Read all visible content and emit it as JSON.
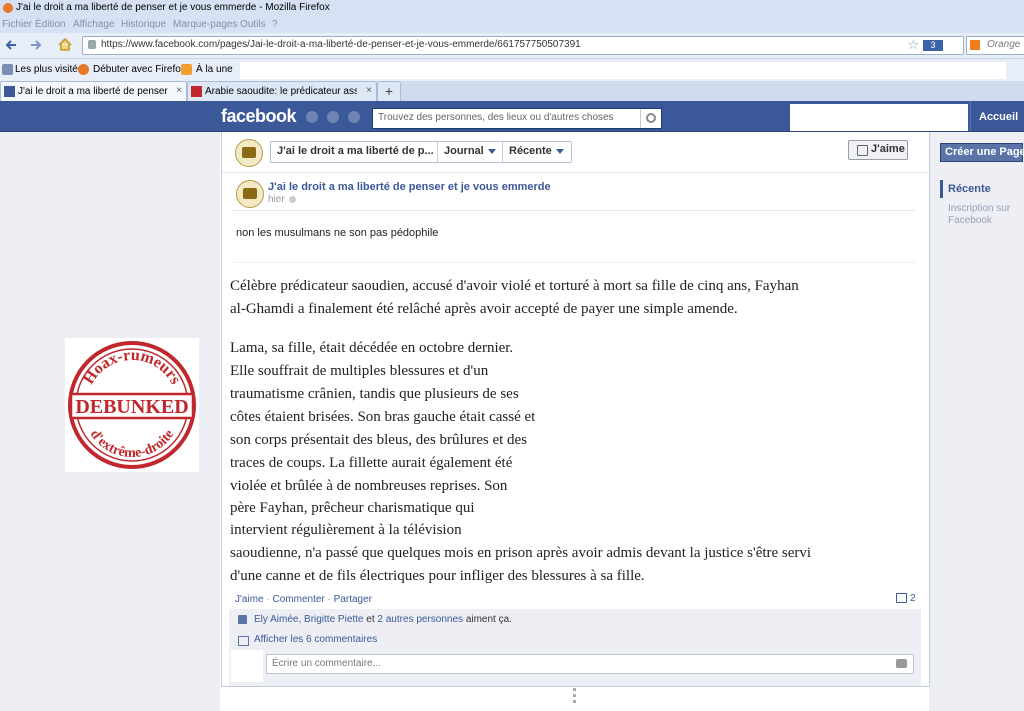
{
  "browser": {
    "window_title": "J'ai le droit a ma liberté de penser et je vous emmerde - Mozilla Firefox",
    "menu": [
      "Fichier",
      "Édition",
      "Affichage",
      "Historique",
      "Marque-pages",
      "Outils",
      "?"
    ],
    "url": "https://www.facebook.com/pages/Jai-le-droit-a-ma-liberté-de-penser-et-je-vous-emmerde/661757750507391",
    "badge_count": "3",
    "search_engine": "Orange",
    "bookmarks": [
      "Les plus visités",
      "Débuter avec Firefox",
      "À la une"
    ],
    "tabs": [
      {
        "label": "J'ai le droit a ma liberté de penser et j...",
        "active": true
      },
      {
        "label": "Arabie saoudite: le prédicateur assassi...",
        "active": false
      }
    ],
    "new_tab_symbol": "+",
    "tab_close_symbol": "×"
  },
  "facebook": {
    "logo": "facebook",
    "search_placeholder": "Trouvez des personnes, des lieux ou d'autres choses",
    "home_label": "Accueil",
    "crumb_page": "J'ai le droit a ma liberté de p...",
    "crumb_journal": "Journal",
    "crumb_recent": "Récente",
    "like_button": "J'aime",
    "create_page": "Créer une Page",
    "sidebar_recent": "Récente",
    "sidebar_signup": "Inscription sur Facebook"
  },
  "post": {
    "author": "J'ai le droit a ma liberté de penser et je vous emmerde",
    "time": "hier",
    "text": "non les musulmans ne son pas pédophile",
    "article_lines": [
      "Célèbre prédicateur saoudien, accusé d'avoir violé et torturé à mort sa fille de cinq ans, Fayhan",
      "al-Ghamdi a finalement été relâché après avoir accepté de payer une simple amende.",
      "Lama, sa fille, était décédée en octobre dernier.",
      "Elle souffrait de multiples blessures et d'un",
      "traumatisme crânien, tandis que plusieurs de ses",
      "côtes étaient brisées. Son bras gauche était cassé et",
      "son corps présentait des bleus, des brûlures et des",
      "traces de coups. La fillette aurait également été",
      "violée et brûlée à de nombreuses reprises. Son",
      "père Fayhan, prêcheur charismatique qui",
      "intervient régulièrement à la télévision",
      "saoudienne, n'a passé que quelques mois en prison après avoir admis devant la justice s'être servi",
      "d'une canne et de fils électriques pour infliger des blessures à sa fille."
    ],
    "stamp": {
      "top": "Hoax-rumeurs",
      "middle": "DEBUNKED",
      "bottom": "d'extrême-droite",
      "color": "#c0282d"
    },
    "actions": {
      "like": "J'aime",
      "comment": "Commenter",
      "share": "Partager",
      "separator": "·"
    },
    "comment_count": "2",
    "likers": "Ely Aimée, Brigitte Piette",
    "likers_joiner": "et",
    "likers_others": "2 autres personnes",
    "likers_suffix": "aiment ça.",
    "view_comments": "Afficher les 6 commentaires",
    "comment_placeholder": "Écrire un commentaire..."
  },
  "colors": {
    "facebook_blue": "#3b5998",
    "stamp_red": "#c0282d"
  }
}
